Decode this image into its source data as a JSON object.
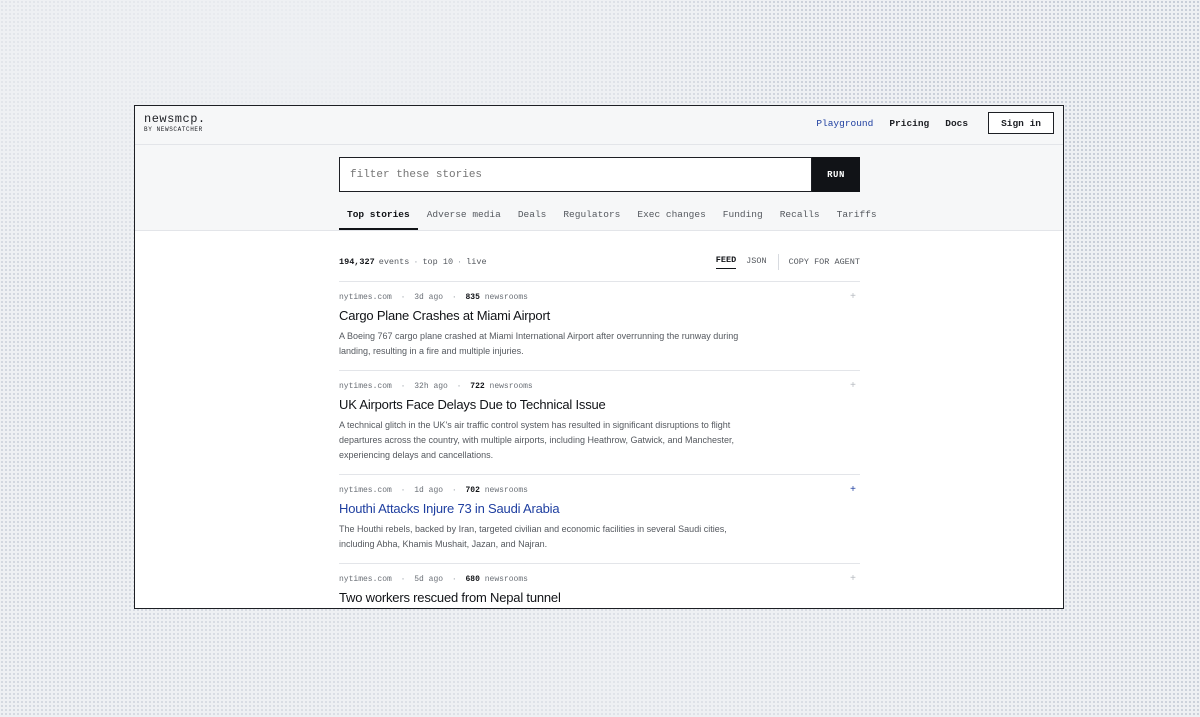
{
  "header": {
    "brand": "newsmcp.",
    "brand_sub": "BY NEWSCATCHER",
    "nav": [
      "Playground",
      "Pricing",
      "Docs"
    ],
    "signin_label": "Sign in"
  },
  "search": {
    "placeholder": "filter these stories",
    "run_label": "RUN"
  },
  "tabs": [
    "Top stories",
    "Adverse media",
    "Deals",
    "Regulators",
    "Exec changes",
    "Funding",
    "Recalls",
    "Tariffs"
  ],
  "stats": {
    "count": "194,327",
    "events_label": "events",
    "top": "top 10",
    "status": "live"
  },
  "views": {
    "feed": "FEED",
    "json": "JSON",
    "copy": "COPY FOR AGENT"
  },
  "stories": [
    {
      "source": "nytimes.com",
      "age": "3d ago",
      "newsrooms": "835",
      "newsrooms_label": "newsrooms",
      "title": "Cargo Plane Crashes at Miami Airport",
      "summary": "A Boeing 767 cargo plane crashed at Miami International Airport after overrunning the runway during landing, resulting in a fire and multiple injuries.",
      "plus": "+"
    },
    {
      "source": "nytimes.com",
      "age": "32h ago",
      "newsrooms": "722",
      "newsrooms_label": "newsrooms",
      "title": "UK Airports Face Delays Due to Technical Issue",
      "summary": "A technical glitch in the UK's air traffic control system has resulted in significant disruptions to flight departures across the country, with multiple airports, including Heathrow, Gatwick, and Manchester, experiencing delays and cancellations.",
      "plus": "+"
    },
    {
      "source": "nytimes.com",
      "age": "1d ago",
      "newsrooms": "702",
      "newsrooms_label": "newsrooms",
      "title": "Houthi Attacks Injure 73 in Saudi Arabia",
      "summary": "The Houthi rebels, backed by Iran, targeted civilian and economic facilities in several Saudi cities, including Abha, Khamis Mushait, Jazan, and Najran.",
      "plus": "+"
    },
    {
      "source": "nytimes.com",
      "age": "5d ago",
      "newsrooms": "680",
      "newsrooms_label": "newsrooms",
      "title": "Two workers rescued from Nepal tunnel",
      "summary": "",
      "plus": "+"
    }
  ],
  "colors": {
    "accent": "#1f3fa0",
    "ink": "#111317",
    "muted": "#55595f"
  }
}
